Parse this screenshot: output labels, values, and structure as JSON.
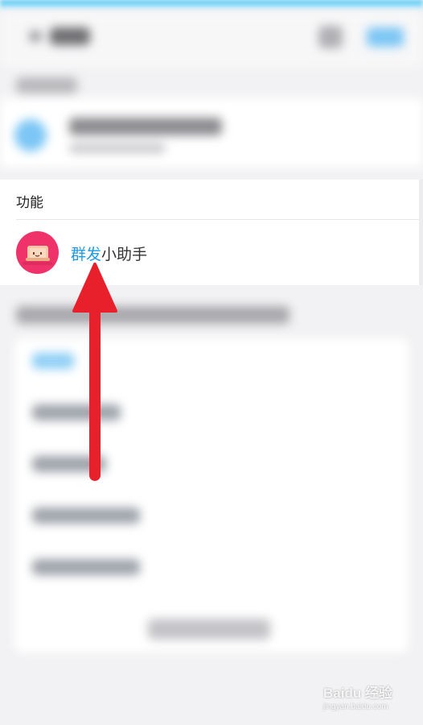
{
  "section": {
    "title": "功能"
  },
  "feature_item": {
    "label_highlight": "群发",
    "label_rest": "小助手"
  },
  "colors": {
    "accent": "#1e9ae6",
    "avatar_bg": "#f0326a",
    "arrow": "#e8202c"
  },
  "icons": {
    "avatar": "mass-message-assistant-icon",
    "annotation": "red-up-arrow"
  },
  "watermark": {
    "main": "Baidu 经验",
    "sub": "jingyan.baidu.com"
  }
}
